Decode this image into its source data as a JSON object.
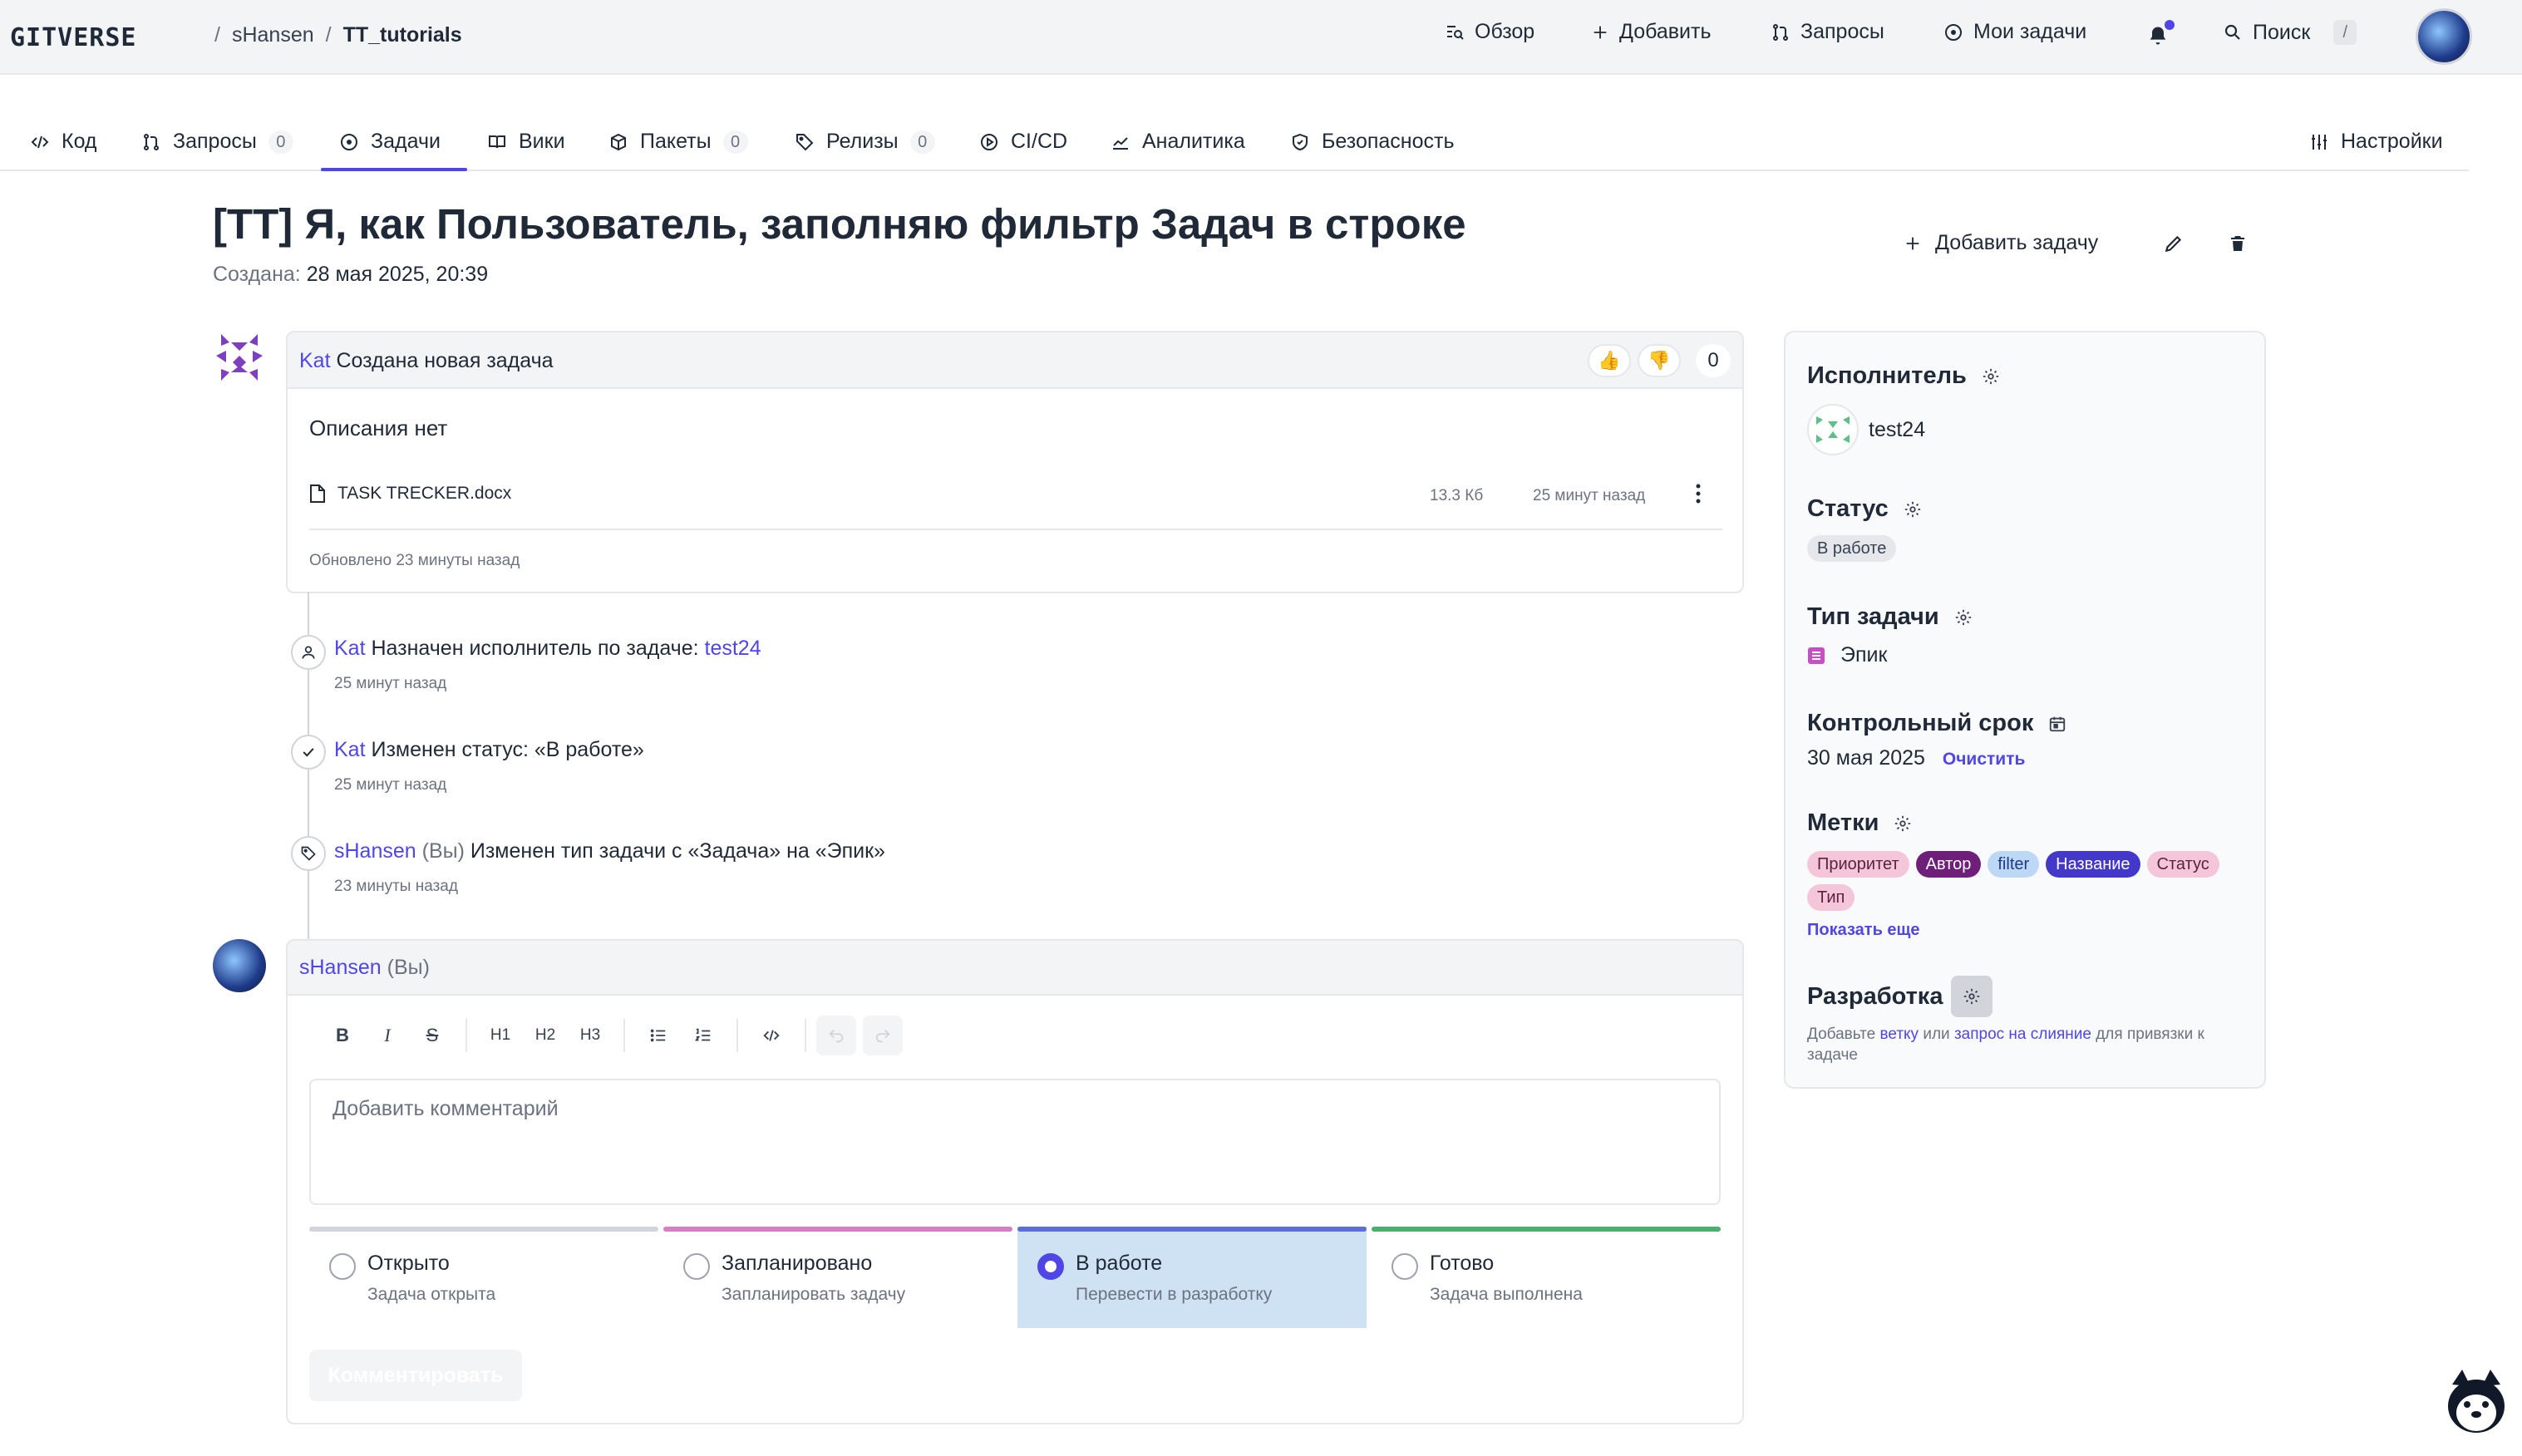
{
  "header": {
    "logo": "GITVERSE",
    "breadcrumb": {
      "owner": "sHansen",
      "repo": "TT_tutorials",
      "sep": "/"
    },
    "nav": {
      "overview": "Обзор",
      "add": "Добавить",
      "requests": "Запросы",
      "my_tasks": "Мои задачи",
      "search": "Поиск",
      "search_key": "/"
    }
  },
  "tabs": [
    {
      "label": "Код"
    },
    {
      "label": "Запросы",
      "count": "0"
    },
    {
      "label": "Задачи"
    },
    {
      "label": "Вики"
    },
    {
      "label": "Пакеты",
      "count": "0"
    },
    {
      "label": "Релизы",
      "count": "0"
    },
    {
      "label": "CI/CD"
    },
    {
      "label": "Аналитика"
    },
    {
      "label": "Безопасность"
    },
    {
      "label": "Настройки"
    }
  ],
  "issue": {
    "title": "[TT] Я, как Пользователь, заполняю фильтр Задач в строке",
    "created_label": "Создана:",
    "created_value": "28 мая 2025, 20:39",
    "add_task": "Добавить задачу"
  },
  "description_card": {
    "author": "Kat",
    "action": "Создана новая задача",
    "reaction_up": "👍",
    "reaction_down": "👎",
    "reaction_count": "0",
    "body": "Описания нет",
    "file_name": "TASK TRECKER.docx",
    "file_size": "13.3 Кб",
    "file_time": "25 минут назад",
    "updated": "Обновлено 23 минуты назад"
  },
  "timeline": [
    {
      "author": "Kat",
      "text": "Назначен исполнитель по задаче:",
      "target": "test24",
      "time": "25 минут назад"
    },
    {
      "author": "Kat",
      "text": "Изменен статус: «В работе»",
      "time": "25 минут назад"
    },
    {
      "author": "sHansen",
      "you": "(Вы)",
      "text": "Изменен тип задачи с «Задача» на «Эпик»",
      "time": "23 минуты назад"
    }
  ],
  "comment": {
    "author": "sHansen",
    "you": "(Вы)",
    "placeholder": "Добавить комментарий",
    "submit": "Комментировать",
    "toolbar": {
      "bold": "B",
      "italic": "I",
      "strike": "S",
      "h1": "H1",
      "h2": "H2",
      "h3": "H3"
    }
  },
  "statuses": [
    {
      "label": "Открыто",
      "desc": "Задача открыта",
      "color": "#d1d5db"
    },
    {
      "label": "Запланировано",
      "desc": "Запланировать задачу",
      "color": "#d67fc4"
    },
    {
      "label": "В работе",
      "desc": "Перевести в разработку",
      "color": "#5b6fd6",
      "selected": true
    },
    {
      "label": "Готово",
      "desc": "Задача выполнена",
      "color": "#4caf6e"
    }
  ],
  "sidebar": {
    "assignee_title": "Исполнитель",
    "assignee": "test24",
    "status_title": "Статус",
    "status": "В работе",
    "type_title": "Тип задачи",
    "type": "Эпик",
    "deadline_title": "Контрольный срок",
    "deadline": "30 мая 2025",
    "clear": "Очистить",
    "labels_title": "Метки",
    "labels": [
      "Приоритет",
      "Автор",
      "filter",
      "Название",
      "Статус",
      "Тип"
    ],
    "show_more": "Показать еще",
    "dev_title": "Разработка",
    "dev_text_1": "Добавьте",
    "dev_link_branch": "ветку",
    "dev_text_2": "или",
    "dev_link_mr": "запрос на слияние",
    "dev_text_3": "для привязки к задаче"
  }
}
